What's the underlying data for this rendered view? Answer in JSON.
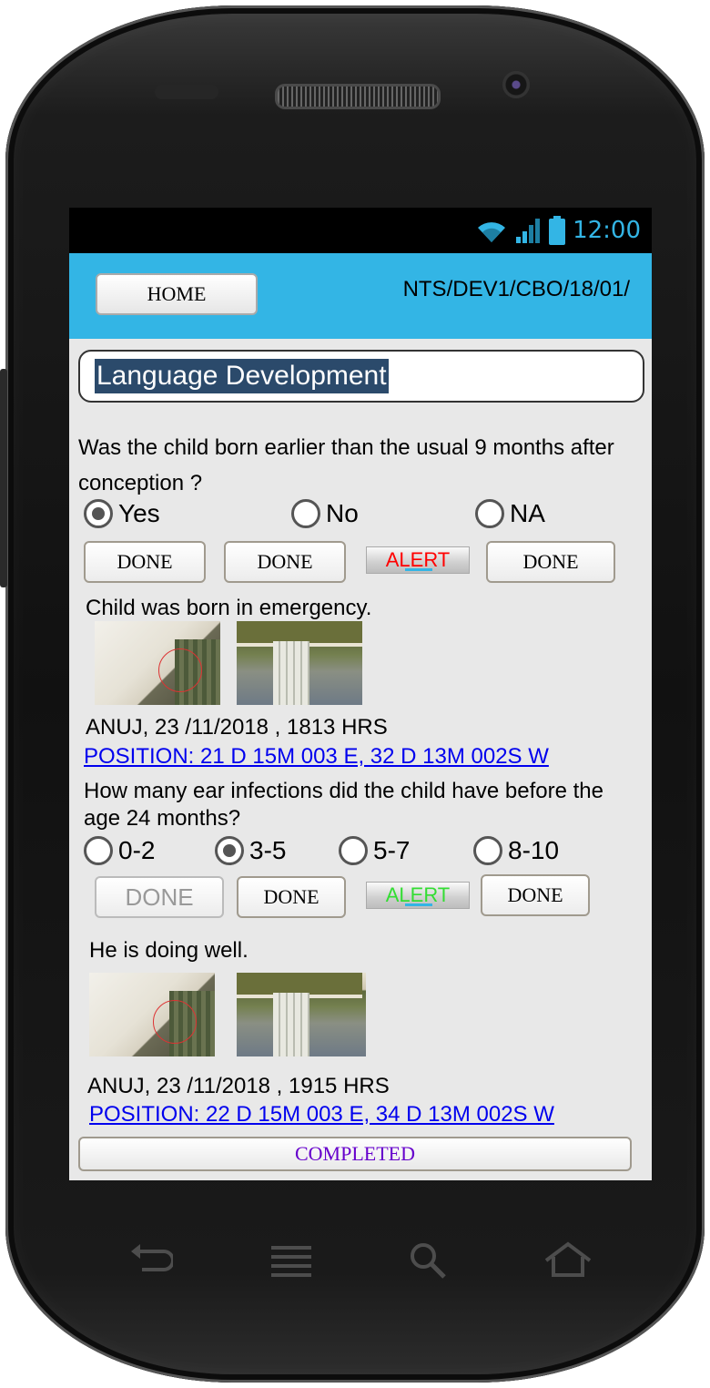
{
  "status_bar": {
    "time": "12:00"
  },
  "app_bar": {
    "home_label": "HOME",
    "code": "NTS/DEV1/CBO/18/01/"
  },
  "section_title": "Language Development",
  "question1": {
    "text": "Was the child born earlier than the usual 9 months after conception ?",
    "options": [
      "Yes",
      "No",
      "NA"
    ],
    "selected": "Yes",
    "buttons": [
      "DONE",
      "DONE",
      "ALERT",
      "DONE"
    ],
    "alert_color": "#ff0000",
    "note": "Child was born in emergency.",
    "stamp": "ANUJ, 23 /11/2018 , 1813 HRS",
    "position": "POSITION: 21 D 15M 003 E, 32 D 13M 002S W"
  },
  "question2": {
    "text": "How many ear infections did the child have before the age 24 months?",
    "options": [
      "0-2",
      "3-5",
      "5-7",
      "8-10"
    ],
    "selected": "3-5",
    "buttons": [
      "DONE",
      "DONE",
      "ALERT",
      "DONE"
    ],
    "alert_color": "#33dd33",
    "note": "He is doing well.",
    "stamp": "ANUJ, 23 /11/2018 , 1915 HRS",
    "position": "POSITION: 22 D 15M 003 E, 34 D 13M 002S W"
  },
  "footer": {
    "completed_label": "COMPLETED",
    "completed_color": "#6600cc"
  },
  "icons": [
    "wifi-icon",
    "signal-icon",
    "battery-icon",
    "back-icon",
    "menu-icon",
    "search-icon",
    "home-icon"
  ]
}
